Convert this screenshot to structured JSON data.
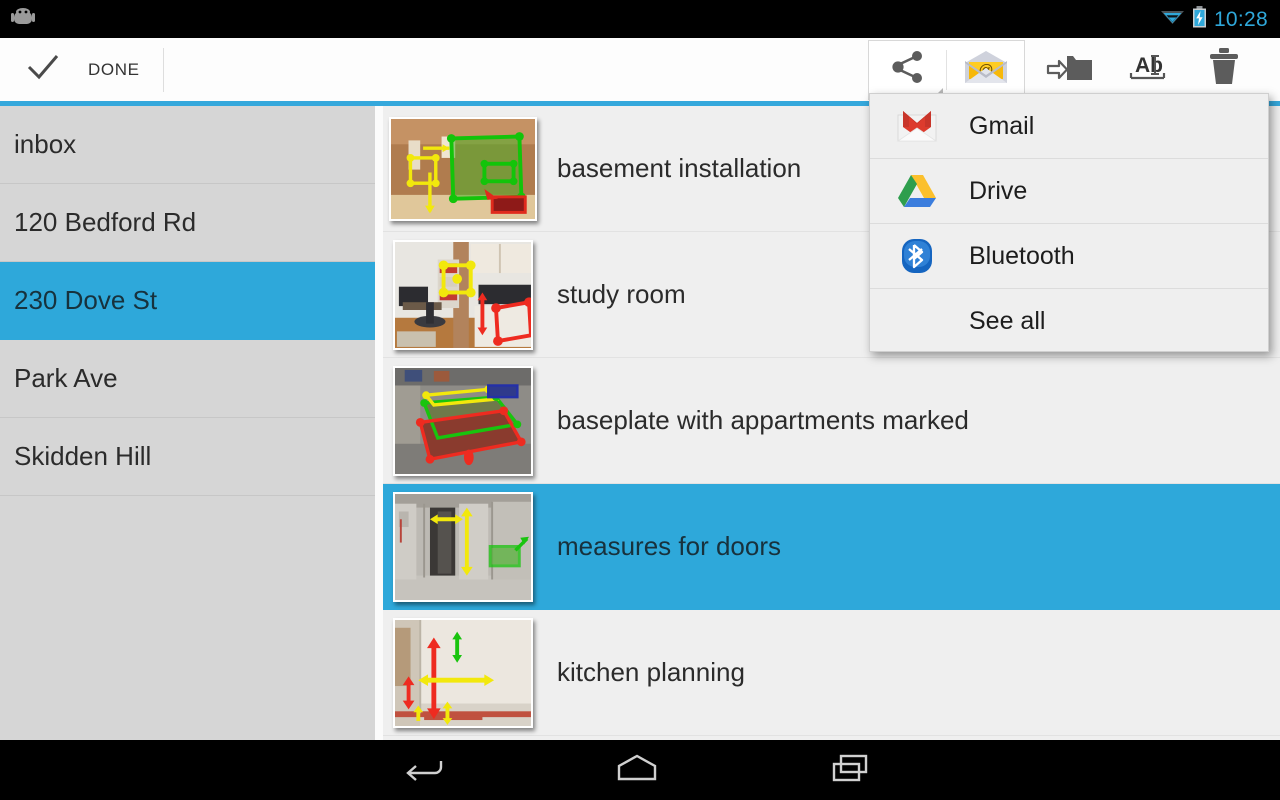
{
  "status_bar": {
    "clock": "10:28",
    "icons": [
      "android-logo-icon",
      "wifi-icon",
      "battery-charging-icon"
    ],
    "accent_color": "#2fa8da"
  },
  "action_bar": {
    "done_label": "DONE",
    "done_icon": "checkmark-icon",
    "buttons": [
      {
        "name": "share-button",
        "icon": "share-icon",
        "label": "Share",
        "active": true,
        "has_dropdown": true
      },
      {
        "name": "email-button",
        "icon": "email-envelope-icon",
        "label": "Email"
      },
      {
        "name": "move-to-folder-button",
        "icon": "move-to-folder-icon",
        "label": "Move to folder"
      },
      {
        "name": "rename-button",
        "icon": "rename-text-icon",
        "label": "Rename"
      },
      {
        "name": "delete-button",
        "icon": "trash-icon",
        "label": "Delete"
      }
    ],
    "accent_rule_color": "#35a8dc"
  },
  "share_menu": {
    "items": [
      {
        "label": "Gmail",
        "icon": "gmail-icon"
      },
      {
        "label": "Drive",
        "icon": "google-drive-icon"
      },
      {
        "label": "Bluetooth",
        "icon": "bluetooth-icon"
      },
      {
        "label": "See all",
        "icon": "none"
      }
    ]
  },
  "sidebar": {
    "items": [
      {
        "label": "inbox",
        "selected": false
      },
      {
        "label": "120 Bedford Rd",
        "selected": false
      },
      {
        "label": "230 Dove St",
        "selected": true
      },
      {
        "label": "Park Ave",
        "selected": false
      },
      {
        "label": "Skidden Hill",
        "selected": false
      }
    ],
    "background_color": "#d6d6d6",
    "selected_color": "#2ea8da"
  },
  "document_list": {
    "items": [
      {
        "title": "basement installation",
        "selected": false,
        "thumbnail": "basement-photo-thumbnail"
      },
      {
        "title": "study room",
        "selected": false,
        "thumbnail": "study-room-photo-thumbnail"
      },
      {
        "title": "baseplate with appartments marked",
        "selected": false,
        "thumbnail": "baseplate-photo-thumbnail"
      },
      {
        "title": "measures for doors",
        "selected": true,
        "thumbnail": "doors-photo-thumbnail"
      },
      {
        "title": "kitchen planning",
        "selected": false,
        "thumbnail": "kitchen-photo-thumbnail"
      }
    ],
    "background_color": "#efefef",
    "selected_color": "#2ea8da"
  },
  "nav_bar": {
    "buttons": [
      {
        "name": "nav-back-button",
        "icon": "back-arrow-icon"
      },
      {
        "name": "nav-home-button",
        "icon": "home-icon"
      },
      {
        "name": "nav-recents-button",
        "icon": "recent-apps-icon"
      }
    ]
  }
}
